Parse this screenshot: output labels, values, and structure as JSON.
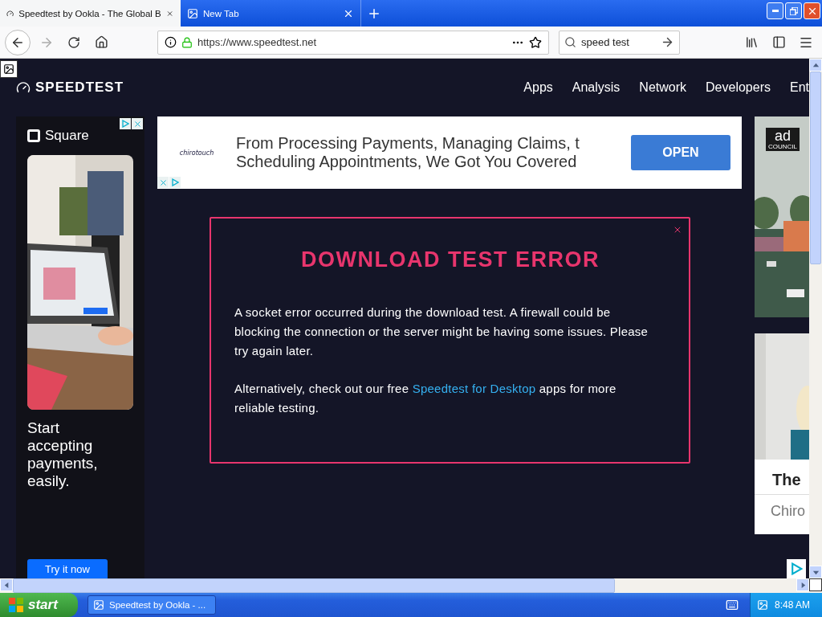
{
  "browser": {
    "tabs": [
      {
        "title": "Speedtest by Ookla - The Global B",
        "selected": true
      },
      {
        "title": "New Tab",
        "selected": false
      }
    ],
    "url": "https://www.speedtest.net",
    "search": {
      "value": "speed test"
    }
  },
  "site": {
    "logo": "SPEEDTEST",
    "nav": [
      "Apps",
      "Analysis",
      "Network",
      "Developers",
      "Ent"
    ]
  },
  "left_ad": {
    "brand": "Square",
    "headline": "Start accepting payments, easily.",
    "button": "Try it now"
  },
  "banner_ad": {
    "brand": "chirotouch",
    "text_lines": [
      "From Processing Payments, Managing Claims, t",
      "Scheduling Appointments, We Got You Covered"
    ],
    "button": "OPEN"
  },
  "right_ads": {
    "logo_lines": [
      "ad",
      "COUNCIL"
    ],
    "title": "The",
    "subtitle": "Chiro"
  },
  "modal": {
    "title": "DOWNLOAD TEST ERROR",
    "paragraph_1": "A socket error occurred during the download test. A firewall could be blocking the connection or the server might be having some issues. Please try again later.",
    "paragraph_2_before": "Alternatively, check out our free ",
    "link": "Speedtest for Desktop",
    "paragraph_2_after": " apps for more reliable testing."
  },
  "taskbar": {
    "start": "start",
    "tasks": [
      {
        "label": "Speedtest by Ookla - ...",
        "selected": false
      }
    ],
    "clock": "8:48 AM"
  }
}
